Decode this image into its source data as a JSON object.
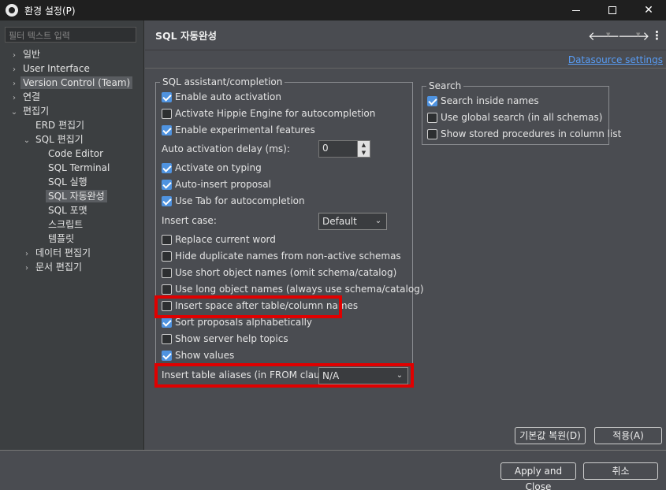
{
  "window": {
    "title": "환경 설정(P)"
  },
  "filter": {
    "placeholder": "필터 텍스트 입력"
  },
  "tree": [
    {
      "label": "일반",
      "arrow": "›"
    },
    {
      "label": "User Interface",
      "arrow": "›"
    },
    {
      "label": "Version Control (Team)",
      "arrow": "›"
    },
    {
      "label": "연결",
      "arrow": "›"
    },
    {
      "label": "편집기",
      "arrow": "⌄"
    },
    {
      "label": "ERD 편집기",
      "arrow": ""
    },
    {
      "label": "SQL 편집기",
      "arrow": "⌄"
    },
    {
      "label": "Code Editor",
      "arrow": ""
    },
    {
      "label": "SQL Terminal",
      "arrow": ""
    },
    {
      "label": "SQL 실행",
      "arrow": ""
    },
    {
      "label": "SQL 자동완성",
      "arrow": ""
    },
    {
      "label": "SQL 포맷",
      "arrow": ""
    },
    {
      "label": "스크립트",
      "arrow": ""
    },
    {
      "label": "템플릿",
      "arrow": ""
    },
    {
      "label": "데이터 편집기",
      "arrow": "›"
    },
    {
      "label": "문서 편집기",
      "arrow": "›"
    }
  ],
  "page": {
    "title": "SQL 자동완성",
    "datasource_link": "Datasource settings"
  },
  "assist": {
    "legend": "SQL assistant/completion",
    "enable_auto": "Enable auto activation",
    "hippie": "Activate Hippie Engine for autocompletion",
    "experimental": "Enable experimental features",
    "delay_label": "Auto activation delay (ms):",
    "delay_value": "0",
    "on_typing": "Activate on typing",
    "auto_insert": "Auto-insert proposal",
    "use_tab": "Use Tab for autocompletion",
    "insert_case_label": "Insert case:",
    "insert_case_value": "Default",
    "replace_word": "Replace current word",
    "hide_dup": "Hide duplicate names from non-active schemas",
    "short_names": "Use short object names (omit schema/catalog)",
    "long_names": "Use long object names (always use schema/catalog)",
    "insert_space": "Insert space after table/column names",
    "sort_alpha": "Sort proposals alphabetically",
    "server_help": "Show server help topics",
    "show_values": "Show values",
    "aliases_label": "Insert table aliases (in FROM clause):",
    "aliases_value": "N/A"
  },
  "search": {
    "legend": "Search",
    "inside": "Search inside names",
    "global": "Use global search (in all schemas)",
    "stored": "Show stored procedures in column list"
  },
  "buttons": {
    "restore": "기본값 복원(D)",
    "apply": "적용(A)",
    "apply_close": "Apply and Close",
    "cancel": "취소"
  },
  "colors": {
    "accent": "#4f93e0",
    "highlight": "#e00000",
    "link": "#589df6"
  }
}
